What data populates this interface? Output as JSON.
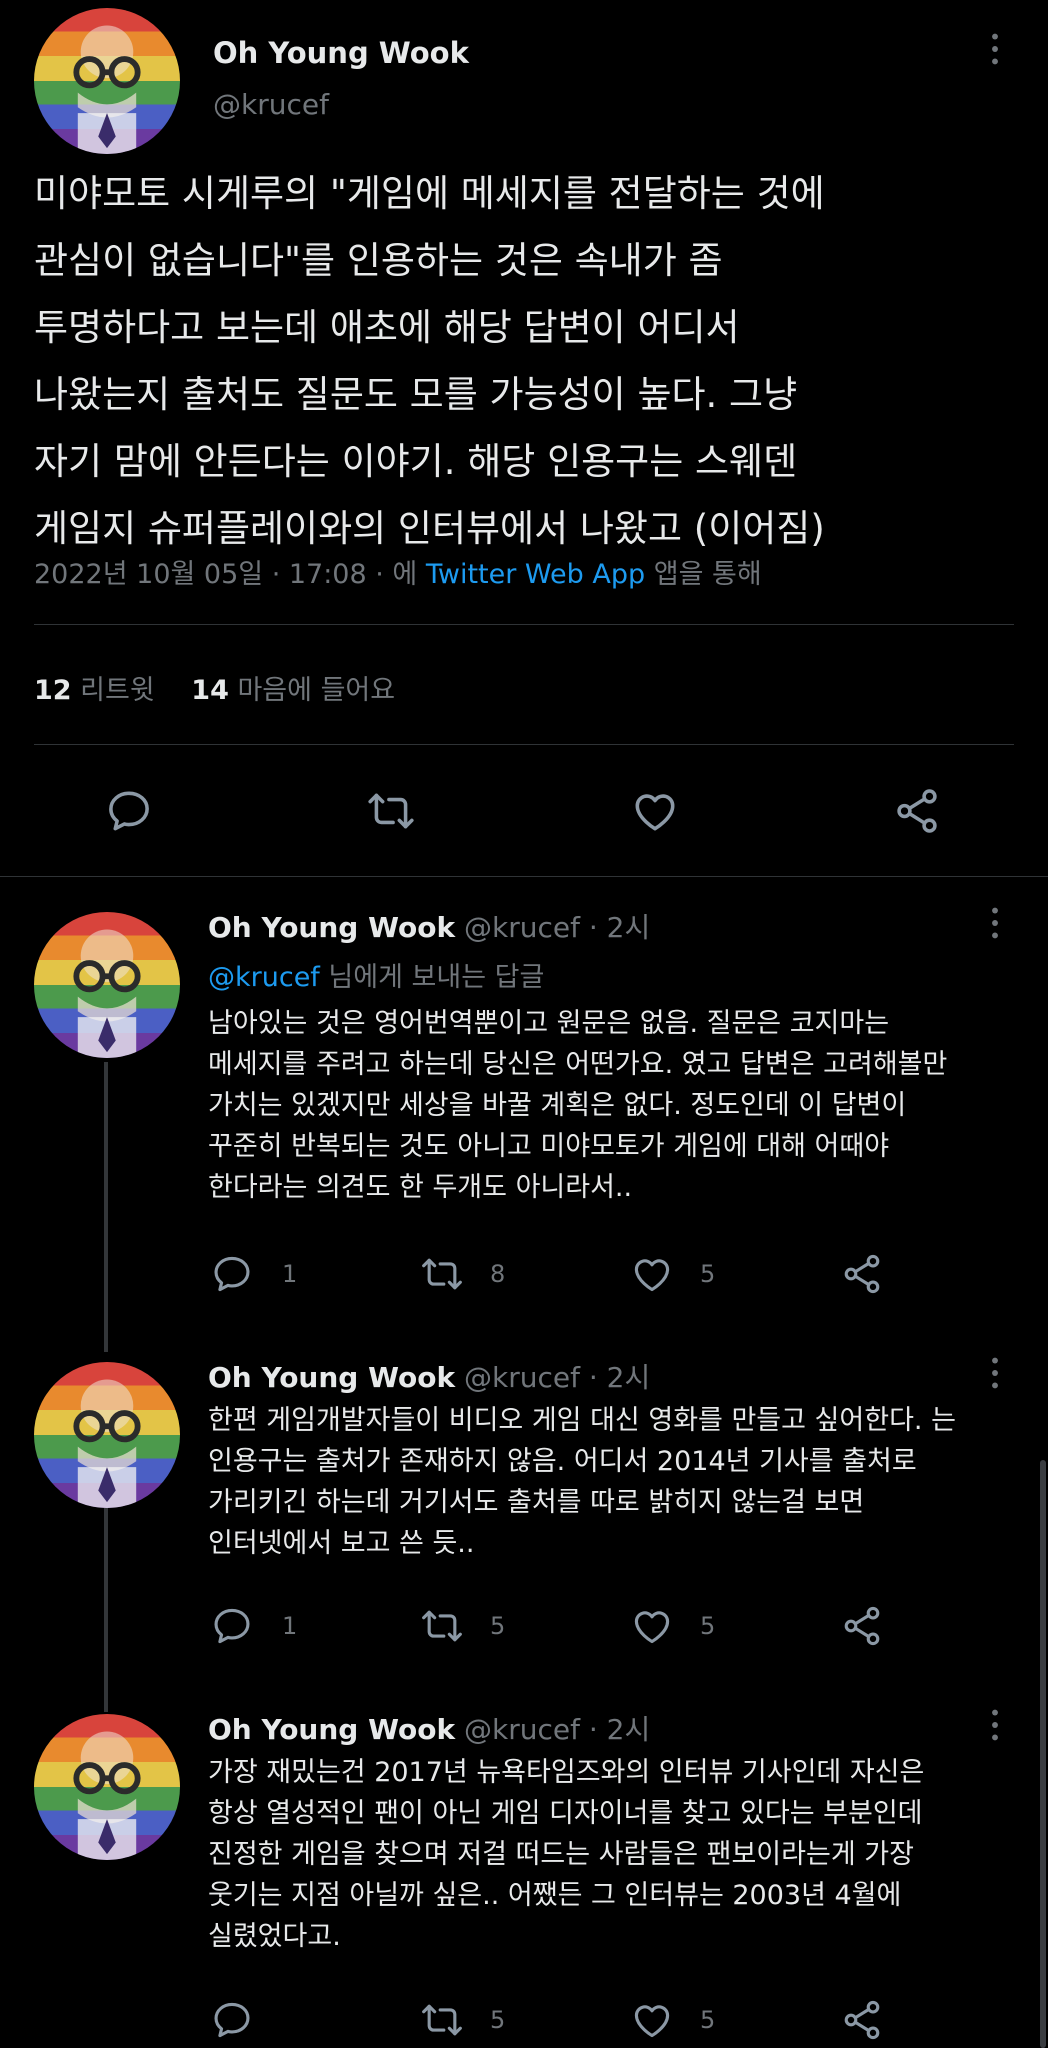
{
  "main_tweet": {
    "author_name": "Oh Young Wook",
    "author_handle": "@krucef",
    "text": "미야모토 시게루의 \"게임에 메세지를 전달하는 것에\n관심이 없습니다\"를 인용하는 것은 속내가 좀\n투명하다고 보는데 애초에 해당 답변이 어디서\n나왔는지 출처도 질문도 모를 가능성이 높다. 그냥\n자기 맘에 안든다는 이야기. 해당 인용구는 스웨덴\n게임지 슈퍼플레이와의 인터뷰에서 나왔고 (이어짐)",
    "date": "2022년 10월 05일 · 17:08 · 에",
    "via_app": "Twitter Web App",
    "via_suffix": "앱을 통해",
    "retweets_count": "12",
    "retweets_label": "리트윗",
    "likes_count": "14",
    "likes_label": "마음에 들어요"
  },
  "replies": [
    {
      "author_name": "Oh Young Wook",
      "author_handle": "@krucef",
      "time": "· 2시",
      "replying_handle": "@krucef",
      "replying_suffix": "님에게 보내는 답글",
      "text": "남아있는 것은 영어번역뿐이고 원문은 없음. 질문은 코지마는\n메세지를 주려고 하는데 당신은 어떤가요. 였고 답변은 고려해볼만\n가치는 있겠지만 세상을 바꿀 계획은 없다. 정도인데 이 답변이\n꾸준히 반복되는 것도 아니고 미야모토가 게임에 대해 어때야\n한다라는 의견도 한 두개도 아니라서..",
      "reply_count": "1",
      "retweet_count": "8",
      "like_count": "5"
    },
    {
      "author_name": "Oh Young Wook",
      "author_handle": "@krucef",
      "time": "· 2시",
      "text": "한편 게임개발자들이 비디오 게임 대신 영화를 만들고 싶어한다. 는\n인용구는 출처가 존재하지 않음.  어디서 2014년 기사를 출처로\n가리키긴 하는데 거기서도 출처를 따로 밝히지 않는걸 보면\n인터넷에서 보고 쓴 듯..",
      "reply_count": "1",
      "retweet_count": "5",
      "like_count": "5"
    },
    {
      "author_name": "Oh Young Wook",
      "author_handle": "@krucef",
      "time": "· 2시",
      "text": "가장 재밌는건 2017년 뉴욕타임즈와의 인터뷰 기사인데 자신은\n항상 열성적인 팬이 아닌 게임 디자이너를 찾고 있다는 부분인데\n진정한 게임을 찾으며 저걸 떠드는 사람들은 팬보이라는게 가장\n웃기는 지점 아닐까 싶은.. 어쨌든 그 인터뷰는 2003년 4월에\n실렸었다고.",
      "reply_count": "",
      "retweet_count": "5",
      "like_count": "5"
    }
  ],
  "icons": {
    "more": "more-icon",
    "reply": "reply-icon",
    "retweet": "retweet-icon",
    "like": "like-icon",
    "share": "share-icon"
  },
  "colors": {
    "background": "#000000",
    "text": "#e7e9ea",
    "muted": "#71767b",
    "link": "#1d9bf0",
    "divider": "#2f3336"
  }
}
